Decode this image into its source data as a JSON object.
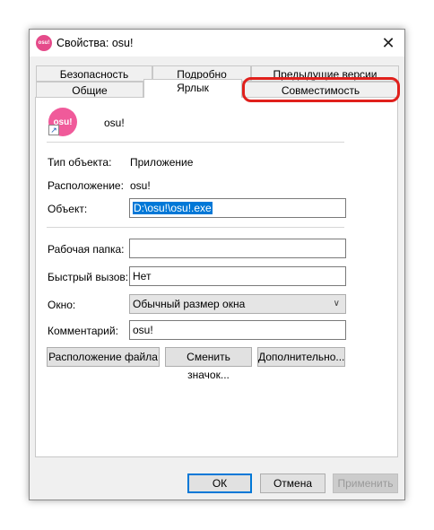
{
  "window": {
    "title": "Свойства: osu!",
    "app_icon_text": "osu!",
    "close_glyph": "✕"
  },
  "tabs": {
    "row1": [
      "Безопасность",
      "Подробно",
      "Предыдущие версии"
    ],
    "row2": [
      "Общие",
      "Ярлык",
      "Совместимость"
    ],
    "active": "Ярлык",
    "highlighted": "Совместимость"
  },
  "header": {
    "icon_text": "osu!",
    "name": "osu!"
  },
  "fields": {
    "type_label": "Тип объекта:",
    "type_value": "Приложение",
    "location_label": "Расположение:",
    "location_value": "osu!",
    "target_label": "Объект:",
    "target_value": "D:\\osu!\\osu!.exe",
    "workdir_label": "Рабочая папка:",
    "workdir_value": "",
    "hotkey_label": "Быстрый вызов:",
    "hotkey_value": "Нет",
    "window_label": "Окно:",
    "window_value": "Обычный размер окна",
    "comment_label": "Комментарий:",
    "comment_value": "osu!"
  },
  "actions": {
    "open_location": "Расположение файла",
    "change_icon": "Сменить значок...",
    "advanced": "Дополнительно..."
  },
  "footer": {
    "ok": "ОК",
    "cancel": "Отмена",
    "apply": "Применить"
  },
  "colors": {
    "accent": "#0078d7",
    "highlight": "#e0201c",
    "osu_pink": "#f05a9a"
  }
}
